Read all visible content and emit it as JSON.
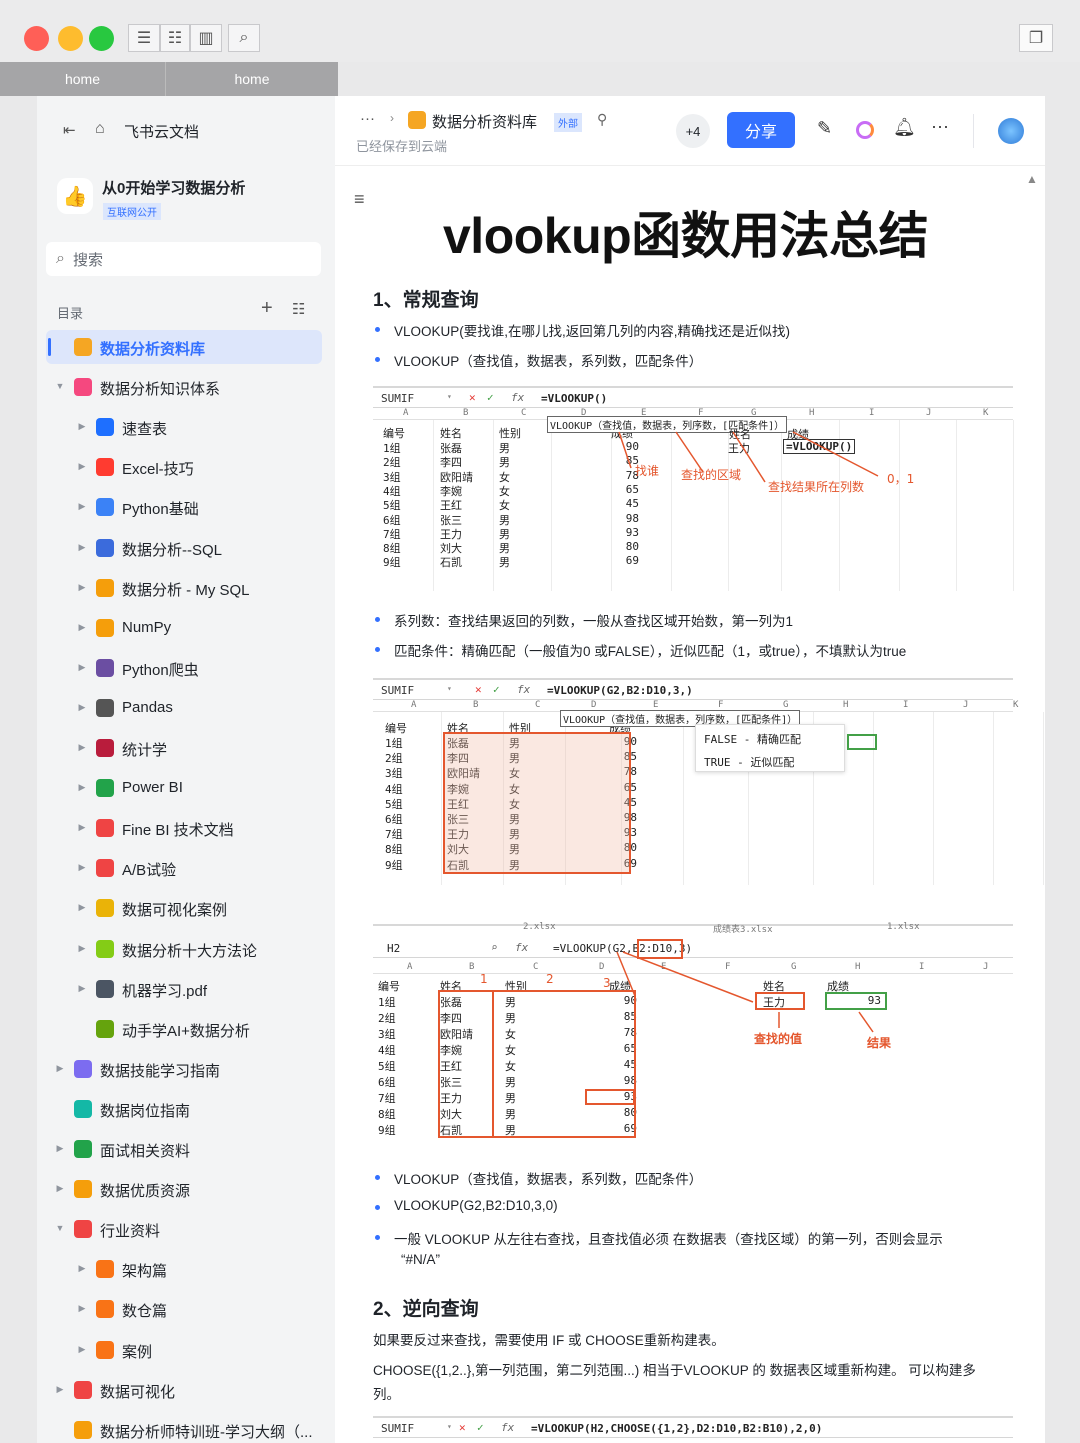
{
  "window": {
    "tabs": [
      "home",
      "home"
    ]
  },
  "sidebar": {
    "brand": "飞书云文档",
    "space_title": "从0开始学习数据分析",
    "space_badge": "互联网公开",
    "search_placeholder": "搜索",
    "toc_label": "目录",
    "items": [
      {
        "label": "数据分析资料库",
        "level": 0,
        "icon_color": "#f5a623",
        "active": true
      },
      {
        "label": "数据分析知识体系",
        "level": 0,
        "icon_color": "#f5487f",
        "expanded": true
      },
      {
        "label": "速查表",
        "level": 1,
        "icon_color": "#1e6fff"
      },
      {
        "label": "Excel-技巧",
        "level": 1,
        "icon_color": "#ff3b30"
      },
      {
        "label": "Python基础",
        "level": 1,
        "icon_color": "#3b82f6"
      },
      {
        "label": "数据分析--SQL",
        "level": 1,
        "icon_color": "#3b6bdc"
      },
      {
        "label": "数据分析 - My SQL",
        "level": 1,
        "icon_color": "#f59e0b"
      },
      {
        "label": "NumPy",
        "level": 1,
        "icon_color": "#f59e0b"
      },
      {
        "label": "Python爬虫",
        "level": 1,
        "icon_color": "#6b4ea2"
      },
      {
        "label": "Pandas",
        "level": 1,
        "icon_color": "#555555"
      },
      {
        "label": "统计学",
        "level": 1,
        "icon_color": "#b91c3c"
      },
      {
        "label": "Power BI",
        "level": 1,
        "icon_color": "#22a34a"
      },
      {
        "label": "Fine BI 技术文档",
        "level": 1,
        "icon_color": "#ef4444"
      },
      {
        "label": "A/B试验",
        "level": 1,
        "icon_color": "#ef4444"
      },
      {
        "label": "数据可视化案例",
        "level": 1,
        "icon_color": "#eab308"
      },
      {
        "label": "数据分析十大方法论",
        "level": 1,
        "icon_color": "#84cc16"
      },
      {
        "label": "机器学习.pdf",
        "level": 1,
        "icon_color": "#4b5563"
      },
      {
        "label": "动手学AI+数据分析",
        "level": 1,
        "icon_color": "#65a30d",
        "no_arrow": true
      },
      {
        "label": "数据技能学习指南",
        "level": 0,
        "icon_color": "#7c6cf0"
      },
      {
        "label": "数据岗位指南",
        "level": 0,
        "icon_color": "#14b8a6",
        "no_arrow": true
      },
      {
        "label": "面试相关资料",
        "level": 0,
        "icon_color": "#22a34a"
      },
      {
        "label": "数据优质资源",
        "level": 0,
        "icon_color": "#f59e0b"
      },
      {
        "label": "行业资料",
        "level": 0,
        "icon_color": "#ef4444",
        "expanded": true
      },
      {
        "label": "架构篇",
        "level": 1,
        "icon_color": "#f97316"
      },
      {
        "label": "数仓篇",
        "level": 1,
        "icon_color": "#f97316"
      },
      {
        "label": "案例",
        "level": 1,
        "icon_color": "#f97316"
      },
      {
        "label": "数据可视化",
        "level": 0,
        "icon_color": "#ef4444"
      },
      {
        "label": "数据分析师特训班-学习大纲（...",
        "level": 0,
        "icon_color": "#f59e0b",
        "no_arrow": true
      }
    ]
  },
  "header": {
    "breadcrumb_more": "···",
    "doc_title": "数据分析资料库",
    "external_badge": "外部",
    "saved_status": "已经保存到云端",
    "collaborators_more": "+4",
    "share_label": "分享"
  },
  "doc": {
    "title": "vlookup函数用法总结",
    "section1": "1、常规查询",
    "b1": "VLOOKUP(要找谁,在哪儿找,返回第几列的内容,精确找还是近似找)",
    "b2": "VLOOKUP（查找值，数据表，系列数，匹配条件）",
    "b3": "系列数：查找结果返回的列数，一般从查找区域开始数，第一列为1",
    "b4": "匹配条件：精确匹配（一般值为0 或FALSE），近似匹配（1，或true），不填默认为true",
    "b5": "VLOOKUP（查找值，数据表，系列数，匹配条件）",
    "b6": "VLOOKUP(G2,B2:D10,3,0)",
    "b7": "一般 VLOOKUP 从左往右查找，且查找值必须 在数据表（查找区域）的第一列，否则会显示",
    "b7b": "“#N/A”",
    "section2": "2、逆向查询",
    "p1": "如果要反过来查找，需要使用 IF 或 CHOOSE重新构建表。",
    "p2": "CHOOSE({1,2..},第一列范围，第二列范围...) 相当于VLOOKUP 的 数据表区域重新构建。 可以构建多",
    "p2b": "列。"
  },
  "sheets": {
    "rows": [
      [
        "1组",
        "张磊",
        "男",
        "90"
      ],
      [
        "2组",
        "李四",
        "男",
        "85"
      ],
      [
        "3组",
        "欧阳靖",
        "女",
        "78"
      ],
      [
        "4组",
        "李婉",
        "女",
        "65"
      ],
      [
        "5组",
        "王红",
        "女",
        "45"
      ],
      [
        "6组",
        "张三",
        "男",
        "98"
      ],
      [
        "7组",
        "王力",
        "男",
        "93"
      ],
      [
        "8组",
        "刘大",
        "男",
        "80"
      ],
      [
        "9组",
        "石凯",
        "男",
        "69"
      ]
    ],
    "headers": [
      "编号",
      "姓名",
      "性别",
      "成绩"
    ],
    "s1": {
      "name_box": "SUMIF",
      "formula": "=VLOOKUP()",
      "tip": "VLOOKUP（查找值，数据表，列序数，[匹配条件]）",
      "g_header": "姓名",
      "g_value": "王力",
      "h_header": "成绩",
      "h_value": "=VLOOKUP()",
      "ann_find": "找谁",
      "ann_area": "查找的区域",
      "ann_col": "查找结果所在列数",
      "ann_match": "0，1"
    },
    "s2": {
      "name_box": "SUMIF",
      "formula": "=VLOOKUP(G2,B2:D10,3,)",
      "tip": "VLOOKUP（查找值，数据表，列序数，[匹配条件]）",
      "opt1": "FALSE - 精确匹配",
      "opt2": "TRUE - 近似匹配"
    },
    "s3": {
      "name_box": "H2",
      "formula": "=VLOOKUP(G2,B2:D10,3)",
      "g_header": "姓名",
      "g_value": "王力",
      "h_header": "成绩",
      "h_value": "93",
      "n1": "1",
      "n2": "2",
      "n3": "3",
      "ann_find": "查找的值",
      "ann_result": "结果",
      "file1": "2.xlsx",
      "file2": "成绩表3.xlsx",
      "file3": "1.xlsx"
    },
    "s4": {
      "name_box": "SUMIF",
      "formula": "=VLOOKUP(H2,CHOOSE({1,2},D2:D10,B2:B10),2,0)"
    },
    "col_letters": [
      "A",
      "B",
      "C",
      "D",
      "E",
      "F",
      "G",
      "H",
      "I",
      "J",
      "K"
    ]
  }
}
